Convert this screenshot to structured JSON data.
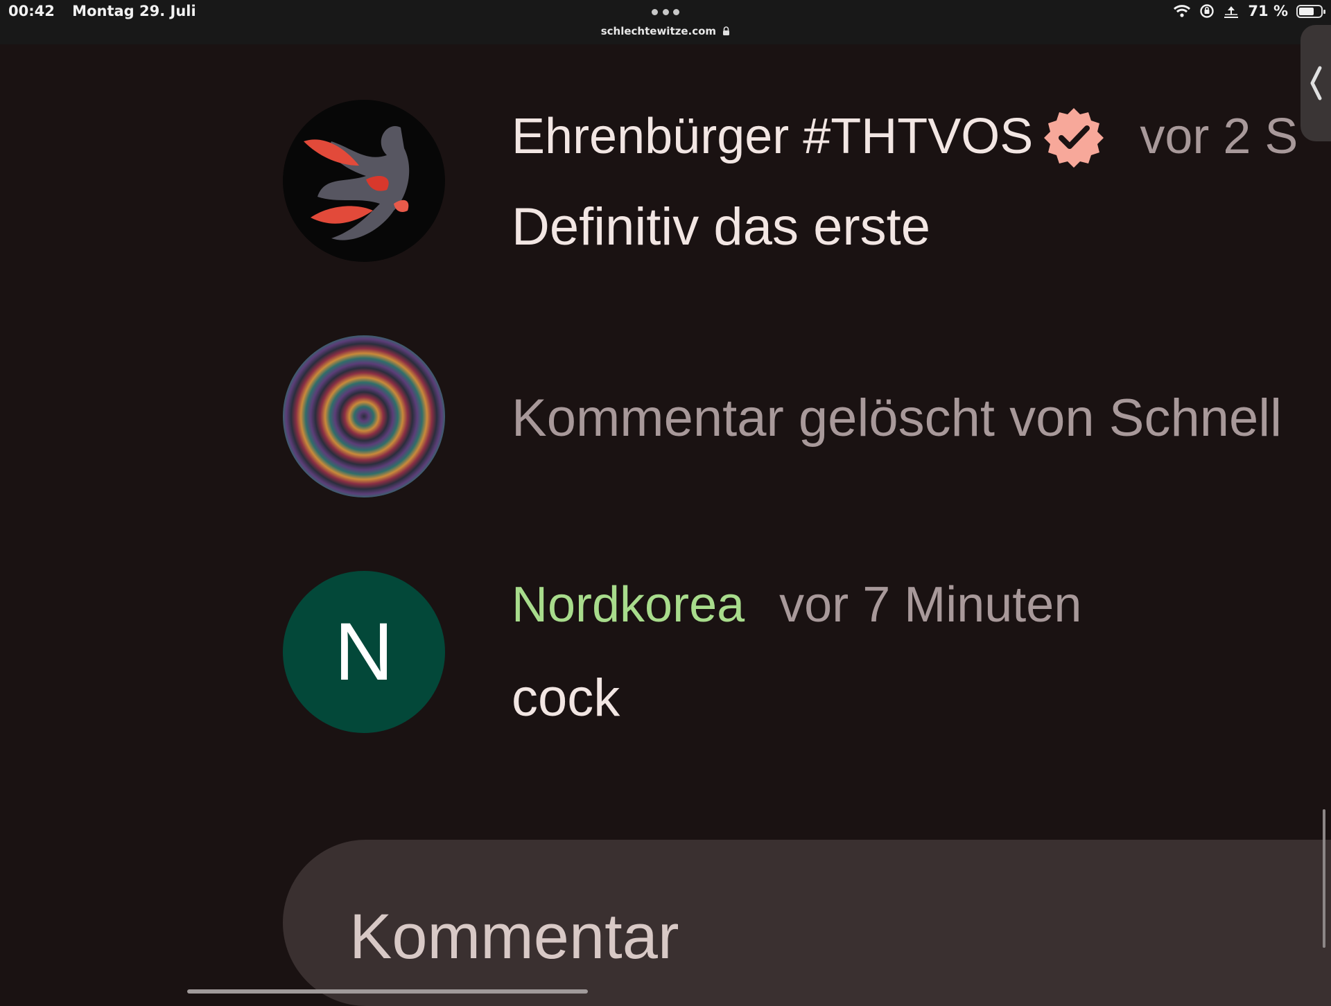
{
  "statusbar": {
    "time": "00:42",
    "date": "Montag 29. Juli",
    "url": "schlechtewitze.com",
    "battery_text": "71 %",
    "battery_level": 0.71,
    "icons": [
      "wifi-icon",
      "rotation-lock-icon",
      "airplay-icon",
      "battery-icon"
    ]
  },
  "comments": [
    {
      "author": "Ehrenbürger #THTVOS",
      "verified": true,
      "time": "vor 2 S",
      "text": "Definitiv das erste",
      "avatar": "creature-avatar"
    },
    {
      "deleted_text": "Kommentar gelöscht von Schnell",
      "avatar": "spiral-avatar"
    },
    {
      "author": "Nordkorea",
      "time": "vor 7 Minuten",
      "text": "cock",
      "avatar_letter": "N"
    }
  ],
  "input": {
    "placeholder": "Kommentar"
  },
  "colors": {
    "background": "#1a1212",
    "author_highlight": "#a8dc8c",
    "verified_badge": "#f7a89a",
    "avatar_letter_bg": "#034839",
    "input_bg": "#3a3030"
  }
}
